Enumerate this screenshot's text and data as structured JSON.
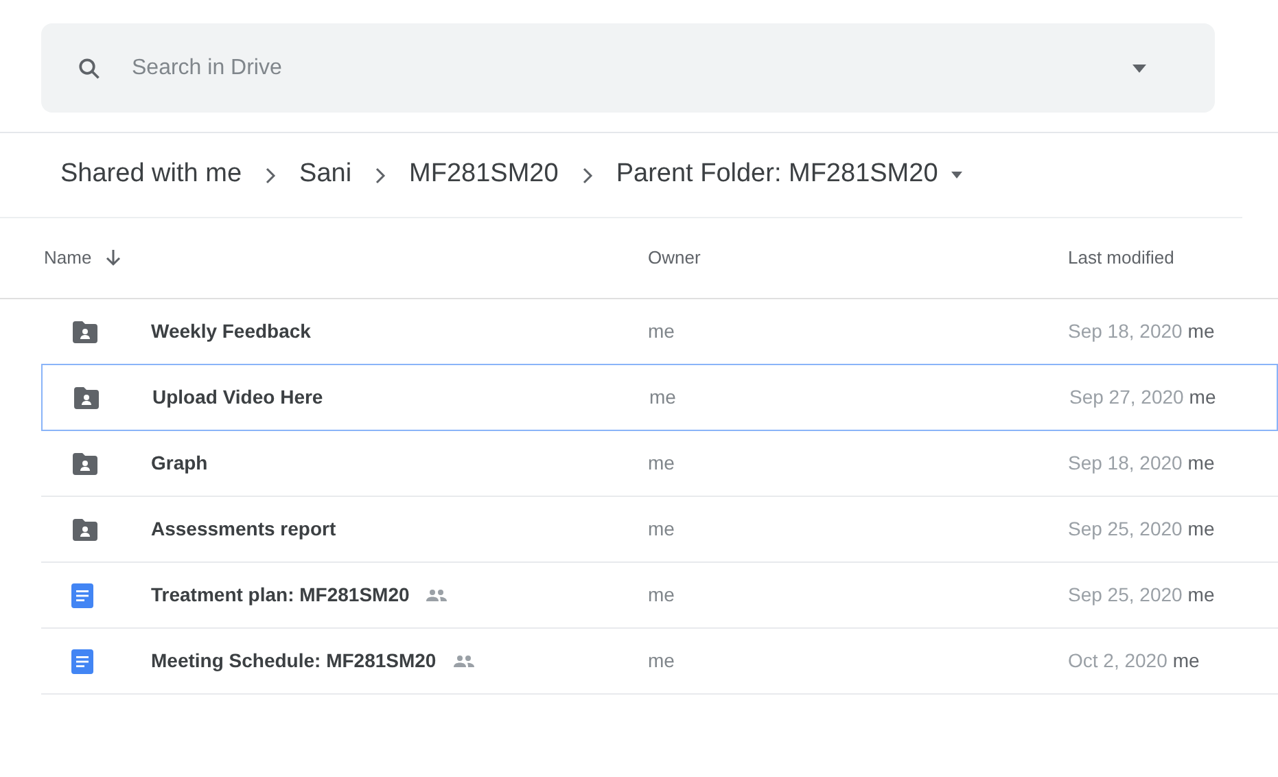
{
  "search": {
    "placeholder": "Search in Drive"
  },
  "breadcrumb": [
    {
      "label": "Shared with me"
    },
    {
      "label": "Sani"
    },
    {
      "label": "MF281SM20"
    },
    {
      "label": "Parent Folder: MF281SM20"
    }
  ],
  "table": {
    "columns": [
      {
        "label": "Name"
      },
      {
        "label": "Owner"
      },
      {
        "label": "Last modified"
      }
    ],
    "rows": [
      {
        "kind": "folder",
        "name": "Weekly Feedback",
        "shared": false,
        "owner": "me",
        "date": "Sep 18, 2020",
        "modifier": "me",
        "selected": false
      },
      {
        "kind": "folder",
        "name": "Upload Video Here",
        "shared": false,
        "owner": "me",
        "date": "Sep 27, 2020",
        "modifier": "me",
        "selected": true
      },
      {
        "kind": "folder",
        "name": "Graph",
        "shared": false,
        "owner": "me",
        "date": "Sep 18, 2020",
        "modifier": "me",
        "selected": false
      },
      {
        "kind": "folder",
        "name": "Assessments report",
        "shared": false,
        "owner": "me",
        "date": "Sep 25, 2020",
        "modifier": "me",
        "selected": false
      },
      {
        "kind": "doc",
        "name": "Treatment plan: MF281SM20",
        "shared": true,
        "owner": "me",
        "date": "Sep 25, 2020",
        "modifier": "me",
        "selected": false
      },
      {
        "kind": "doc",
        "name": "Meeting Schedule: MF281SM20",
        "shared": true,
        "owner": "me",
        "date": "Oct 2, 2020",
        "modifier": "me",
        "selected": false
      }
    ]
  }
}
